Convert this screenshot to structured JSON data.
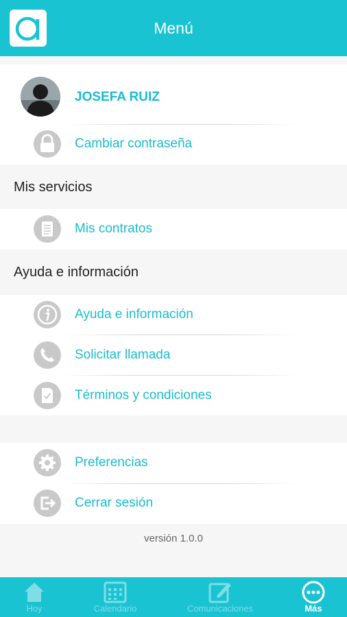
{
  "header": {
    "title": "Menú",
    "logo_letter": "a"
  },
  "user": {
    "name": "JOSEFA RUIZ",
    "avatar_icon": "user-avatar"
  },
  "account_items": [
    {
      "label": "Cambiar contraseña",
      "icon": "lock-icon"
    }
  ],
  "sections": {
    "services_title": "Mis servicios",
    "help_title": "Ayuda e información"
  },
  "services_items": [
    {
      "label": "Mis contratos",
      "icon": "document-icon"
    }
  ],
  "help_items": [
    {
      "label": "Ayuda e información",
      "icon": "info-icon"
    },
    {
      "label": "Solicitar llamada",
      "icon": "phone-icon"
    },
    {
      "label": "Términos y condiciones",
      "icon": "terms-icon"
    }
  ],
  "settings_items": [
    {
      "label": "Preferencias",
      "icon": "gear-icon"
    },
    {
      "label": "Cerrar sesión",
      "icon": "logout-icon"
    }
  ],
  "version": "versión 1.0.0",
  "tabs": [
    {
      "label": "Hoy",
      "icon": "home-icon",
      "active": false
    },
    {
      "label": "Calendario",
      "icon": "calendar-icon",
      "active": false
    },
    {
      "label": "Comunicaciones",
      "icon": "edit-icon",
      "active": false
    },
    {
      "label": "Más",
      "icon": "more-icon",
      "active": true
    }
  ],
  "colors": {
    "accent": "#19c3d2",
    "link": "#19bcd0",
    "icon_bg": "#c9c9c9"
  }
}
